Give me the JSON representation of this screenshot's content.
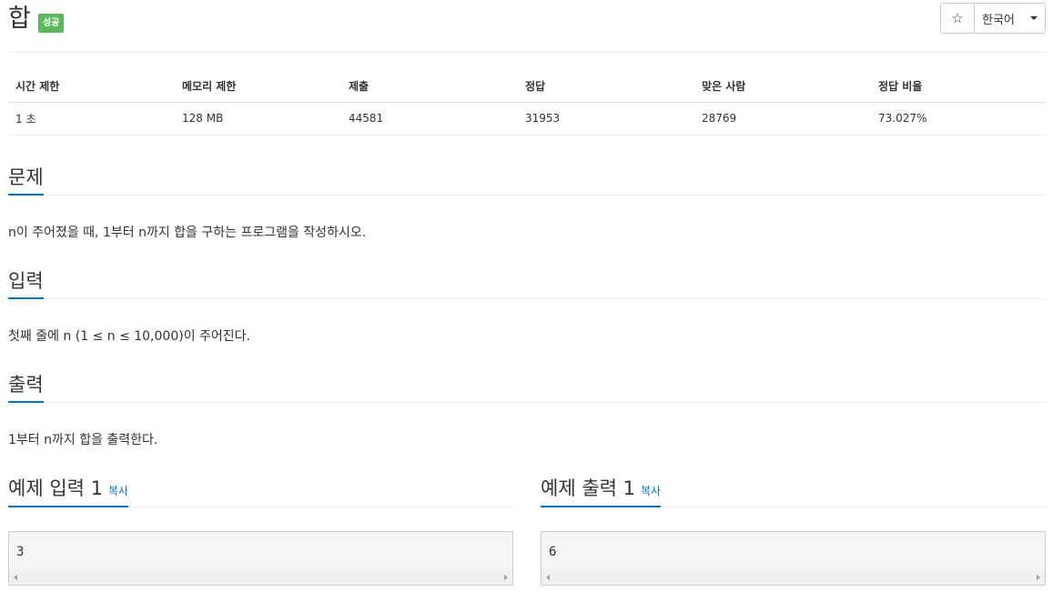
{
  "header": {
    "title": "합",
    "status_badge": "성공",
    "star_icon": "☆",
    "language": "한국어"
  },
  "info_table": {
    "headers": [
      "시간 제한",
      "메모리 제한",
      "제출",
      "정답",
      "맞은 사람",
      "정답 비율"
    ],
    "row": [
      "1 초",
      "128 MB",
      "44581",
      "31953",
      "28769",
      "73.027%"
    ]
  },
  "problem": {
    "title": "문제",
    "text": "n이 주어졌을 때, 1부터 n까지 합을 구하는 프로그램을 작성하시오."
  },
  "input": {
    "title": "입력",
    "text": "첫째 줄에 n (1 ≤ n ≤ 10,000)이 주어진다."
  },
  "output": {
    "title": "출력",
    "text": "1부터 n까지 합을 출력한다."
  },
  "sample_input": {
    "title": "예제 입력 1",
    "copy_label": "복사",
    "value": "3"
  },
  "sample_output": {
    "title": "예제 출력 1",
    "copy_label": "복사",
    "value": "6"
  },
  "colors": {
    "accent": "#0076c0",
    "success": "#5cb85c"
  }
}
